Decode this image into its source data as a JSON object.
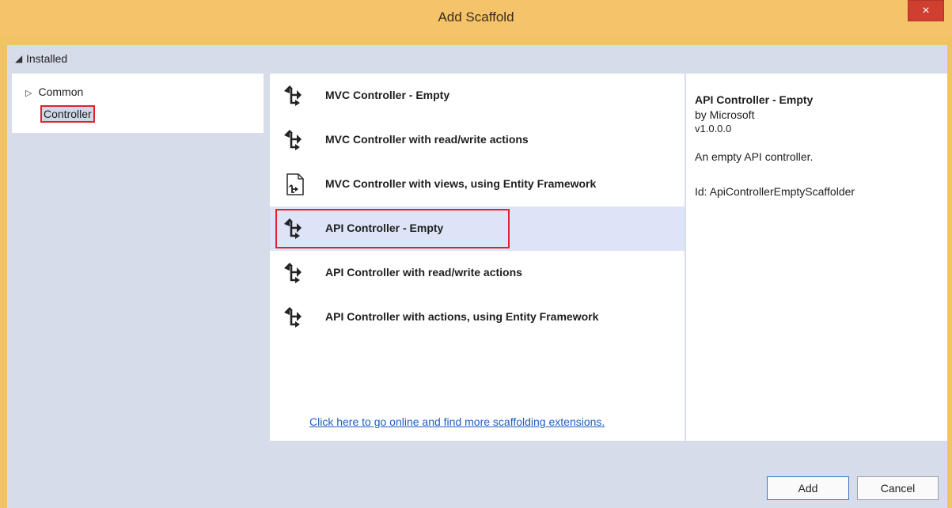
{
  "window": {
    "title": "Add Scaffold",
    "close_glyph": "×"
  },
  "categories": {
    "installed_label": "Installed",
    "items": [
      {
        "label": "Common",
        "expand_glyph": "▷"
      },
      {
        "label": "Controller"
      }
    ]
  },
  "templates": [
    {
      "label": "MVC Controller - Empty",
      "icon": "controller-icon"
    },
    {
      "label": "MVC Controller with read/write actions",
      "icon": "controller-icon"
    },
    {
      "label": "MVC Controller with views, using Entity Framework",
      "icon": "controller-views-icon"
    },
    {
      "label": "API Controller - Empty",
      "icon": "controller-icon",
      "selected": true
    },
    {
      "label": "API Controller with read/write actions",
      "icon": "controller-icon"
    },
    {
      "label": "API Controller with actions, using Entity Framework",
      "icon": "controller-icon"
    }
  ],
  "online_link": "Click here to go online and find more scaffolding extensions.",
  "details": {
    "title": "API Controller - Empty",
    "author": "by Microsoft",
    "version": "v1.0.0.0",
    "description": "An empty API controller.",
    "id_text": "Id: ApiControllerEmptyScaffolder"
  },
  "buttons": {
    "add": "Add",
    "cancel": "Cancel"
  },
  "colors": {
    "accent": "#f0c462",
    "selection": "#dee4f7",
    "highlight": "#e3212a",
    "link": "#1f5ec7"
  }
}
